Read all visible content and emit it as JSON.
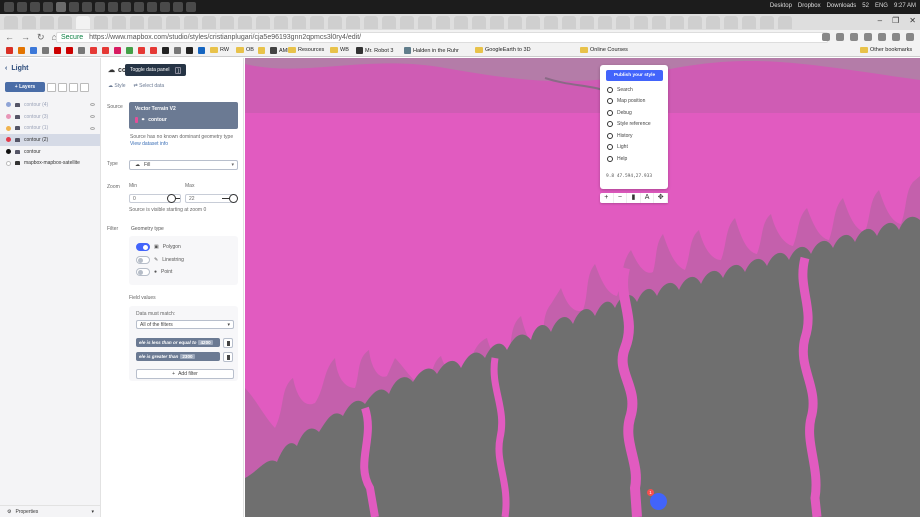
{
  "taskbar": {
    "tray_desktop": "Desktop",
    "tray_dropbox": "Dropbox",
    "tray_downloads": "Downloads",
    "tray_volume": "52",
    "tray_lang": "ENG",
    "clock": "9:27 AM"
  },
  "browser": {
    "secure_label": "Secure",
    "url": "https://www.mapbox.com/studio/styles/cristianplugari/cja5e96193gnn2qpmcs3l0ry4/edit/",
    "bookmarks": [
      "RW",
      "OB",
      "Resources",
      "WB",
      "Mr. Robot 3",
      "Halden in the Ruhr",
      "GoogleEarth to 3D",
      "Online Courses"
    ],
    "other_bookmarks": "Other bookmarks"
  },
  "sidebar": {
    "style_name": "Light",
    "layers_button": "Layers",
    "layers": [
      {
        "name": "contour (4)",
        "color": "#8fa4d6",
        "selected": false,
        "dark": false,
        "eye": true
      },
      {
        "name": "contour (3)",
        "color": "#e896b8",
        "selected": false,
        "dark": false,
        "eye": true
      },
      {
        "name": "contour (1)",
        "color": "#f0b34f",
        "selected": false,
        "dark": false,
        "eye": true
      },
      {
        "name": "contour (2)",
        "color": "#e23c4d",
        "selected": true,
        "dark": true,
        "eye": false
      },
      {
        "name": "contour",
        "color": "#111111",
        "selected": false,
        "dark": true,
        "eye": false
      },
      {
        "name": "mapbox-mapbox-satellite",
        "color": "#ffffff",
        "selected": false,
        "dark": true,
        "eye": false
      }
    ],
    "footer": "Properties"
  },
  "editor": {
    "title": "co",
    "tooltip": "Toggle data panel",
    "tooltip_key": "]",
    "tab_style": "Style",
    "tab_select": "Select data",
    "source_label": "Source",
    "source_name": "Vector Terrain V2",
    "source_layer": "contour",
    "source_note": "Source has no known dominant geometry type",
    "view_info": "View dataset info",
    "type_label": "Type",
    "type_value": "Fill",
    "zoom_label": "Zoom",
    "min_label": "Min",
    "max_label": "Max",
    "min_value": "0",
    "max_value": "22",
    "zoom_note": "Source is visible starting at zoom 0",
    "filter_label": "Filter",
    "geometry_type_label": "Geometry type",
    "geom_options": [
      {
        "label": "Polygon",
        "on": true
      },
      {
        "label": "Linestring",
        "on": false
      },
      {
        "label": "Point",
        "on": false
      }
    ],
    "field_values_label": "Field values",
    "data_must_match": "Data must match:",
    "match_value": "All of the filters",
    "filters": [
      {
        "text": "ele is less than or equal to",
        "value": "4200"
      },
      {
        "text": "ele is greater than",
        "value": "2300"
      }
    ],
    "add_filter": "Add filter"
  },
  "map_panel": {
    "publish_label": "Publish your style",
    "items": [
      "Search",
      "Map position",
      "Debug",
      "Style reference",
      "History",
      "Light",
      "Help"
    ],
    "coords": "9.8   47.594,27.933",
    "controls": [
      "+",
      "−",
      "▮",
      "A",
      "✥"
    ],
    "help_badge": "1"
  },
  "colors": {
    "map_fill": "#e15bc0",
    "terrain": "#6f6f6f",
    "accent": "#4264fb"
  }
}
